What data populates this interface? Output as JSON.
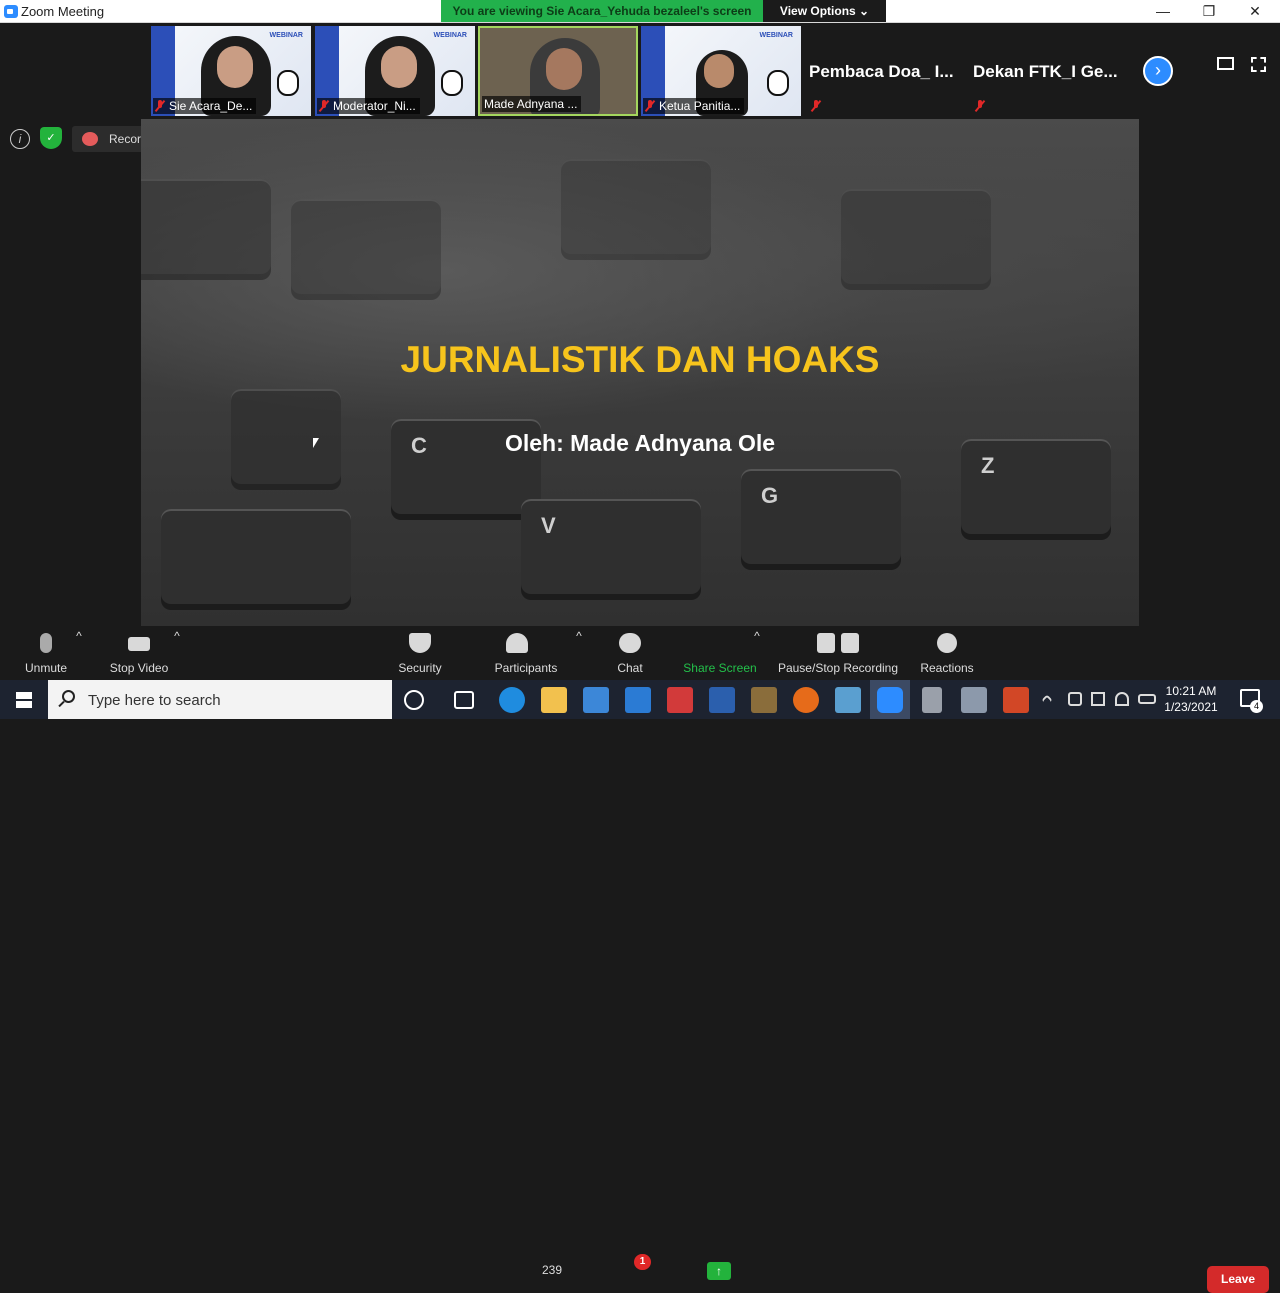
{
  "window": {
    "title": "Zoom Meeting"
  },
  "share_banner": {
    "text": "You are viewing Sie Acara_Yehuda bezaleel's screen",
    "view_options": "View Options ⌄"
  },
  "window_controls": {
    "minimize": "—",
    "maximize": "❐",
    "close": "✕"
  },
  "participants_strip": [
    {
      "name": "Sie Acara_De...",
      "video": true,
      "muted": true
    },
    {
      "name": "Moderator_Ni...",
      "video": true,
      "muted": true
    },
    {
      "name": "Made Adnyana ...",
      "video": true,
      "muted": false,
      "active_speaker": true
    },
    {
      "name": "Ketua Panitia...",
      "video": true,
      "muted": true
    },
    {
      "name": "Pembaca Doa_ I...",
      "video": false,
      "muted": true
    },
    {
      "name": "Dekan FTK_I Ge...",
      "video": false,
      "muted": true
    }
  ],
  "card": {
    "webinar": "WEBINAR"
  },
  "next_page": "›",
  "meeting_info": {
    "info": "i",
    "secure": "✓"
  },
  "recording": {
    "label": "Recording..."
  },
  "slide": {
    "title": "JURNALISTIK DAN HOAKS",
    "subtitle": "Oleh: Made Adnyana Ole",
    "keys": [
      "C",
      "V",
      "G",
      "Z"
    ]
  },
  "toolbar": {
    "unmute": "Unmute",
    "stop_video": "Stop Video",
    "security": "Security",
    "participants": "Participants",
    "participant_count": "239",
    "chat": "Chat",
    "chat_unread": "1",
    "share_screen": "Share Screen",
    "share_arrow": "↑",
    "recording": "Pause/Stop Recording",
    "reactions": "Reactions",
    "leave": "Leave",
    "caret": "^"
  },
  "taskbar": {
    "search_placeholder": "Type here to search",
    "time": "10:21 AM",
    "date": "1/23/2021",
    "notification_count": "4"
  },
  "colors": {
    "accent": "#2d8cff",
    "share_green": "#22b14c",
    "leave_red": "#d42a2a",
    "title_yellow": "#f7c41c"
  }
}
